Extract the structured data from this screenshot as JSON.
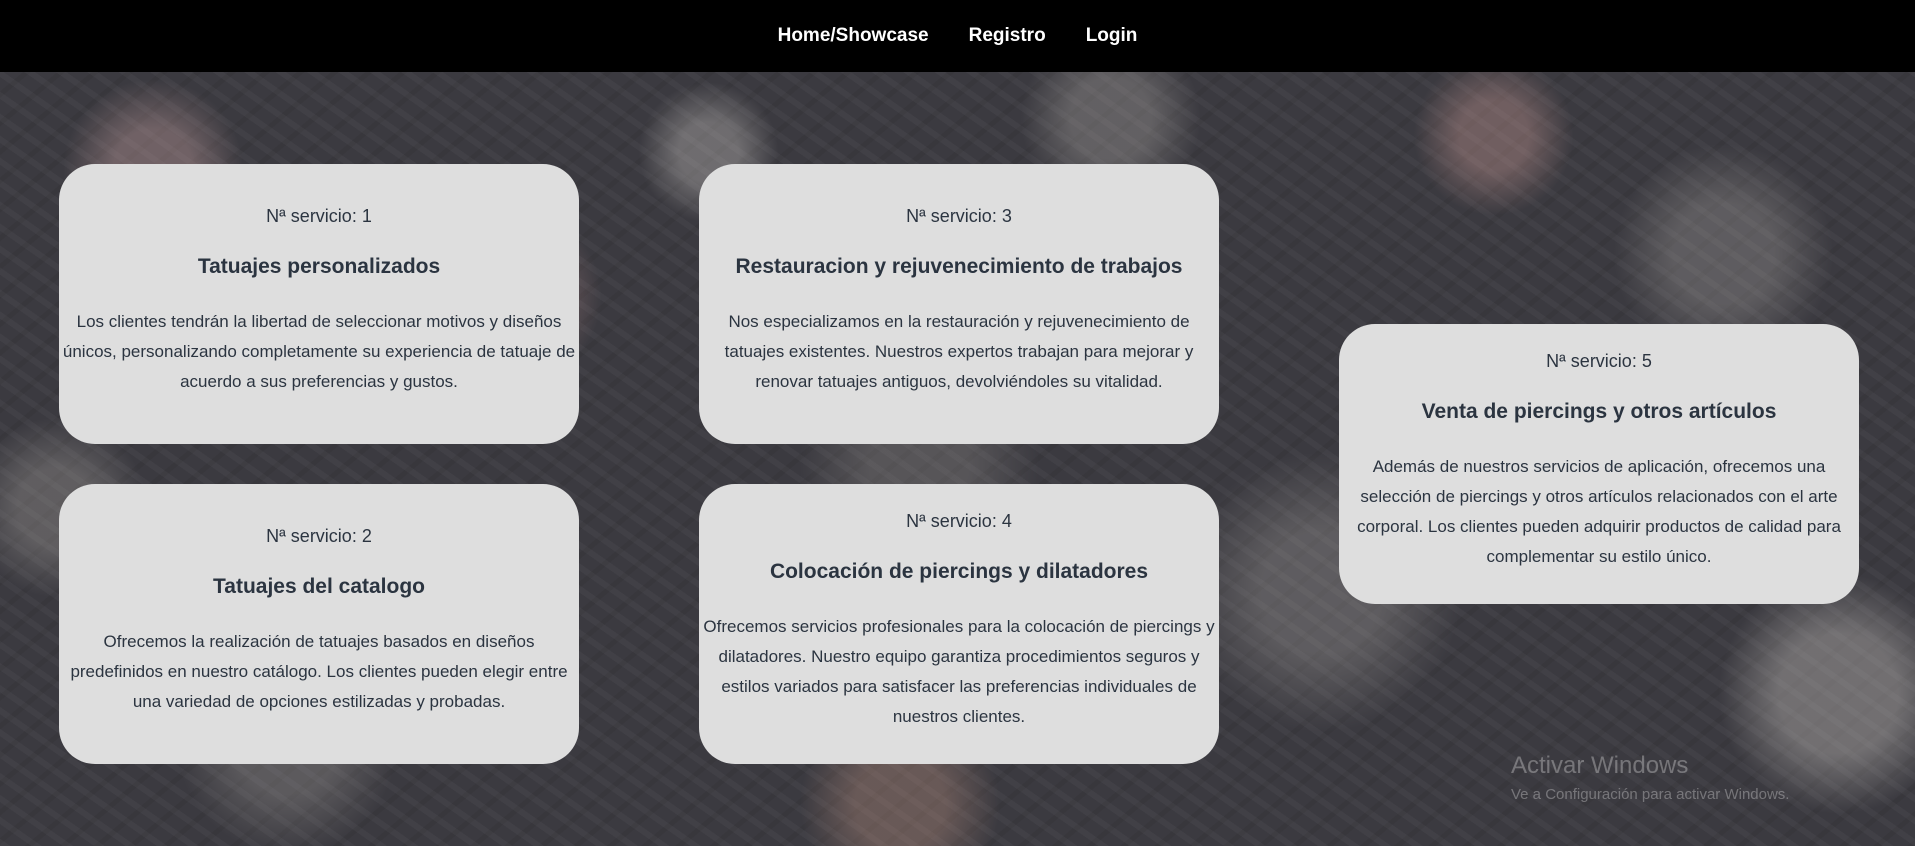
{
  "nav": {
    "links": [
      {
        "label": "Home/Showcase"
      },
      {
        "label": "Registro"
      },
      {
        "label": "Login"
      }
    ]
  },
  "services": [
    {
      "number": "Nª servicio: 1",
      "title": "Tatuajes personalizados",
      "description": "Los clientes tendrán la libertad de seleccionar motivos y diseños únicos, personalizando completamente su experiencia de tatuaje de acuerdo a sus preferencias y gustos."
    },
    {
      "number": "Nª servicio: 2",
      "title": "Tatuajes del catalogo",
      "description": "Ofrecemos la realización de tatuajes basados en diseños predefinidos en nuestro catálogo. Los clientes pueden elegir entre una variedad de opciones estilizadas y probadas."
    },
    {
      "number": "Nª servicio: 3",
      "title": "Restauracion y rejuvenecimiento de trabajos",
      "description": "Nos especializamos en la restauración y rejuvenecimiento de tatuajes existentes. Nuestros expertos trabajan para mejorar y renovar tatuajes antiguos, devolviéndoles su vitalidad."
    },
    {
      "number": "Nª servicio: 4",
      "title": "Colocación de piercings y dilatadores",
      "description": "Ofrecemos servicios profesionales para la colocación de piercings y dilatadores. Nuestro equipo garantiza procedimientos seguros y estilos variados para satisfacer las preferencias individuales de nuestros clientes."
    },
    {
      "number": "Nª servicio: 5",
      "title": "Venta de piercings y otros artículos",
      "description": "Además de nuestros servicios de aplicación, ofrecemos una selección de piercings y otros artículos relacionados con el arte corporal. Los clientes pueden adquirir productos de calidad para complementar su estilo único."
    }
  ],
  "watermark": {
    "title": "Activar Windows",
    "subtitle": "Ve a Configuración para activar Windows."
  }
}
